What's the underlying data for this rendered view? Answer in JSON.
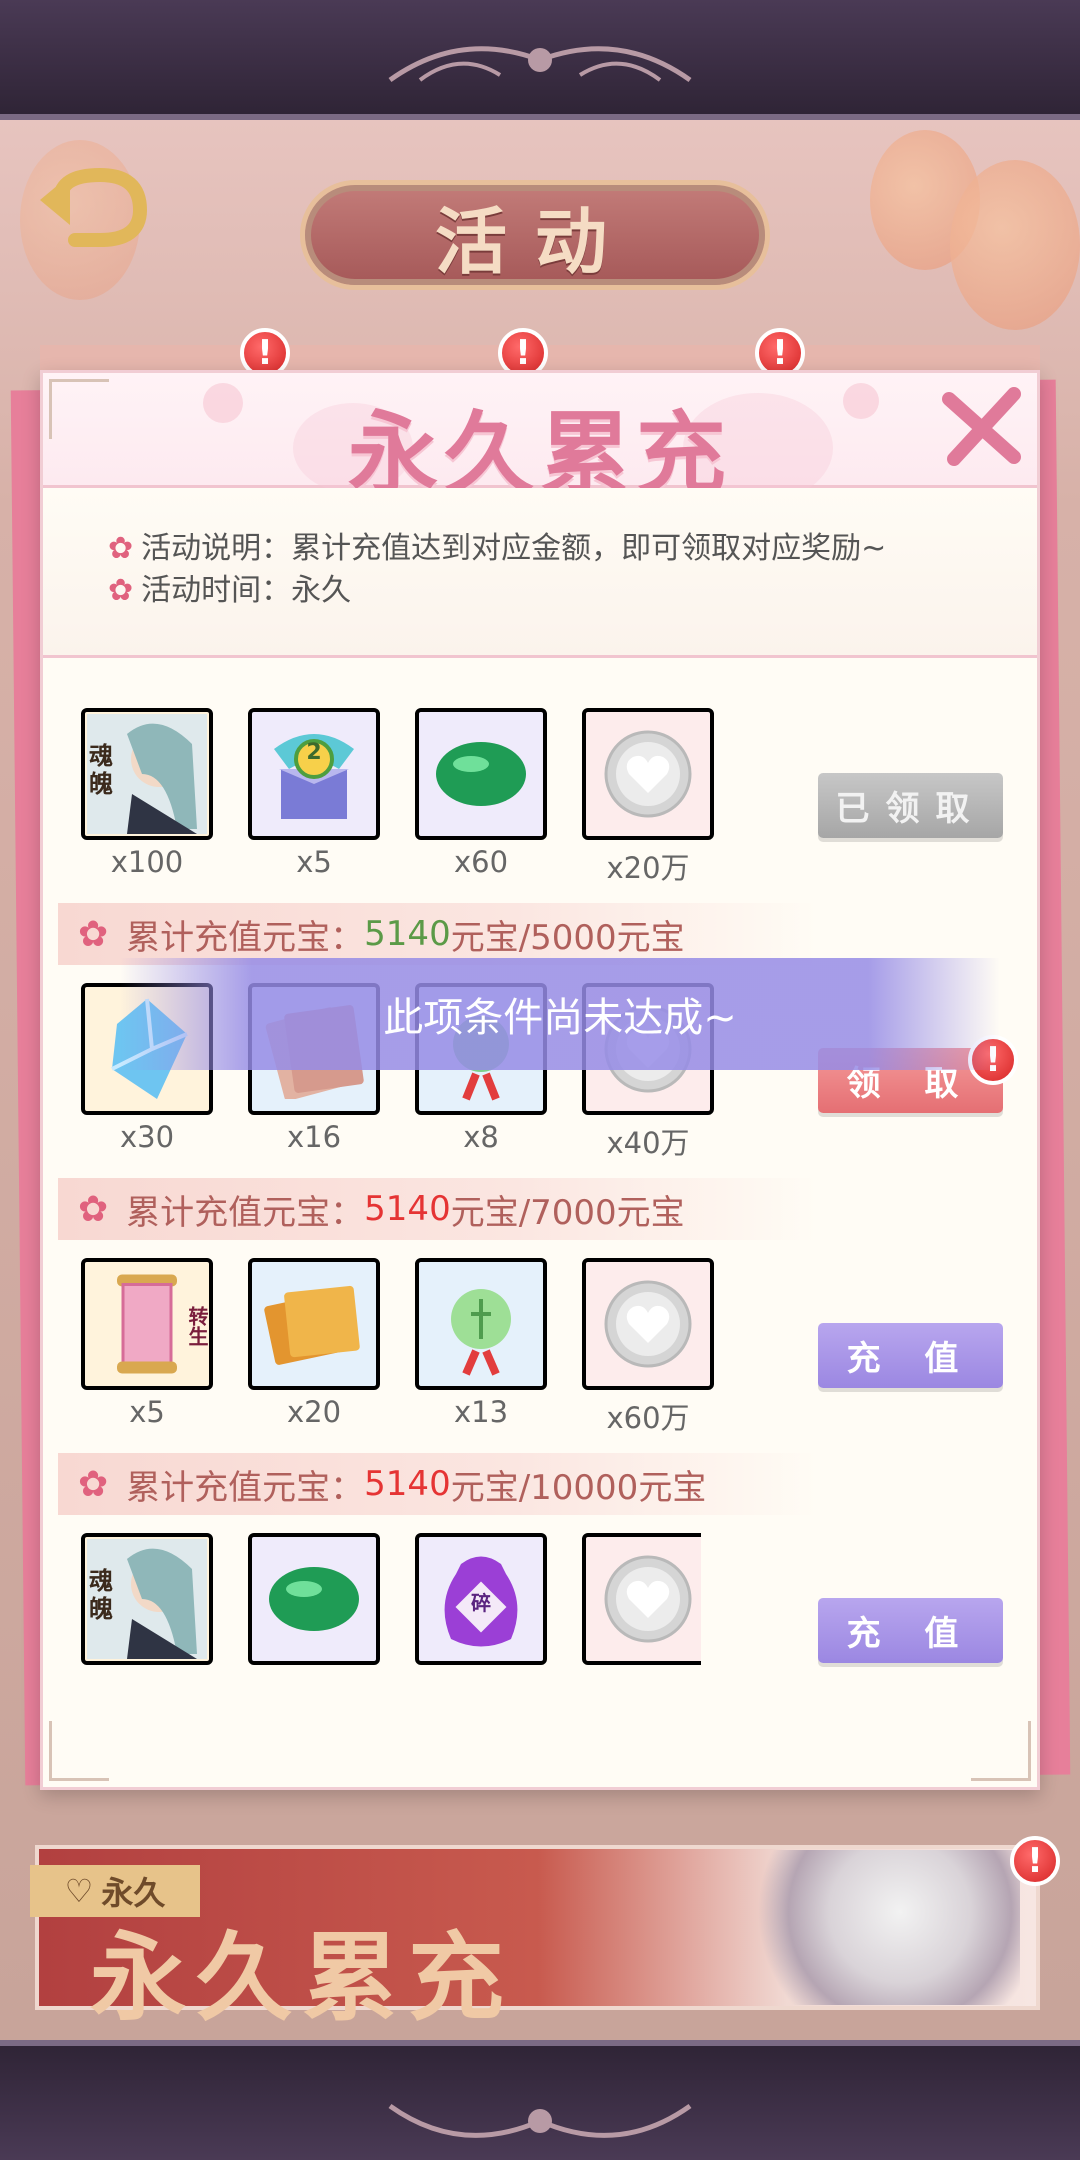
{
  "header": {
    "title": "活动"
  },
  "popup": {
    "title": "永久累充",
    "description": [
      "活动说明：累计充值达到对应金额，即可领取对应奖励~",
      "活动时间：永久"
    ]
  },
  "tiers": [
    {
      "items": [
        {
          "icon": "soul-card-icon",
          "qty": "x100"
        },
        {
          "icon": "gift-box-icon",
          "qty": "x5"
        },
        {
          "icon": "jade-stone-icon",
          "qty": "x60"
        },
        {
          "icon": "silver-coin-icon",
          "qty": "x20万"
        }
      ],
      "button": "已领取"
    },
    {
      "condition": {
        "label": "累计充值元宝：",
        "current": "5140",
        "suffix": "元宝/5000元宝"
      },
      "items": [
        {
          "icon": "crystal-icon",
          "qty": "x30"
        },
        {
          "icon": "book-icon",
          "qty": "x16"
        },
        {
          "icon": "pendant-icon",
          "qty": "x8"
        },
        {
          "icon": "silver-coin-icon",
          "qty": "x40万"
        }
      ],
      "button": "领 取",
      "overlay": "此项条件尚未达成~"
    },
    {
      "condition": {
        "label": "累计充值元宝：",
        "current": "5140",
        "suffix": "元宝/7000元宝"
      },
      "items": [
        {
          "icon": "rebirth-scroll-icon",
          "qty": "x5"
        },
        {
          "icon": "gold-book-icon",
          "qty": "x20"
        },
        {
          "icon": "jade-pendant-icon",
          "qty": "x13"
        },
        {
          "icon": "silver-coin-icon",
          "qty": "x60万"
        }
      ],
      "button": "充 值"
    },
    {
      "condition": {
        "label": "累计充值元宝：",
        "current": "5140",
        "suffix": "元宝/10000元宝"
      },
      "items": [
        {
          "icon": "soul-card-icon"
        },
        {
          "icon": "jade-stone-icon"
        },
        {
          "icon": "fragment-bag-icon"
        },
        {
          "icon": "silver-coin-icon"
        }
      ],
      "button": "充 值"
    }
  ],
  "item_text": {
    "soul_card": "魂魄",
    "gift_level": "2",
    "rebirth": "转生",
    "fragment": "碎"
  },
  "banner": {
    "tag": "永久",
    "title": "永久累充"
  },
  "colors": {
    "accent_pink": "#e07a9a",
    "reached": "#5b9a47",
    "not_reached": "#e53434",
    "button_purple": "#9b87e2"
  }
}
